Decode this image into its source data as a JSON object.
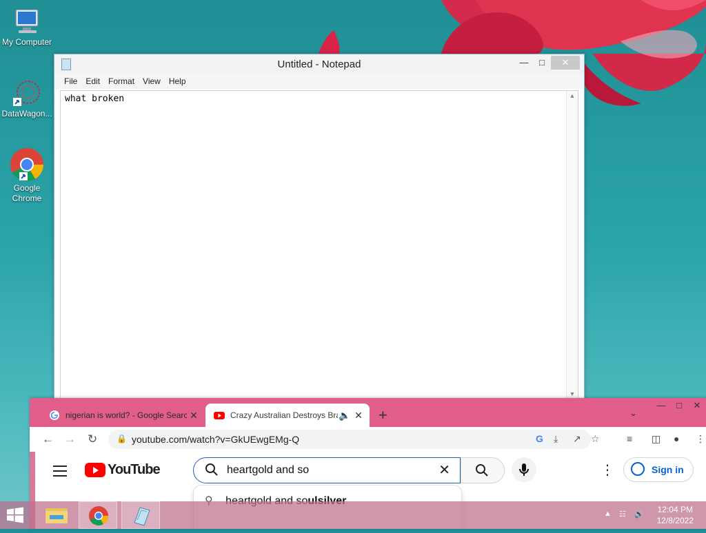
{
  "desktop": {
    "icons": [
      {
        "label": "My Computer"
      },
      {
        "label": "DataWagon..."
      },
      {
        "label": "Google Chrome"
      }
    ]
  },
  "notepad": {
    "title": "Untitled - Notepad",
    "menu": [
      "File",
      "Edit",
      "Format",
      "View",
      "Help"
    ],
    "content": "what broken"
  },
  "chrome": {
    "tabs": [
      {
        "title": "nigerian is world? - Google Searc",
        "active": false
      },
      {
        "title": "Crazy Australian Destroys Bra",
        "active": true,
        "audio": true
      }
    ],
    "url": "youtube.com/watch?v=GkUEwgEMg-Q"
  },
  "youtube": {
    "logo_text": "YouTube",
    "search_value": "heartgold and so",
    "sign_in": "Sign in",
    "suggestions": [
      {
        "typed": "heartgold and so",
        "rest": "ulsilver"
      }
    ]
  },
  "taskbar": {
    "time": "12:04 PM",
    "date": "12/8/2022"
  },
  "colors": {
    "youtube_red": "#ff0000",
    "signin_blue": "#065fd4",
    "chrome_frame": "#e15e8a"
  }
}
